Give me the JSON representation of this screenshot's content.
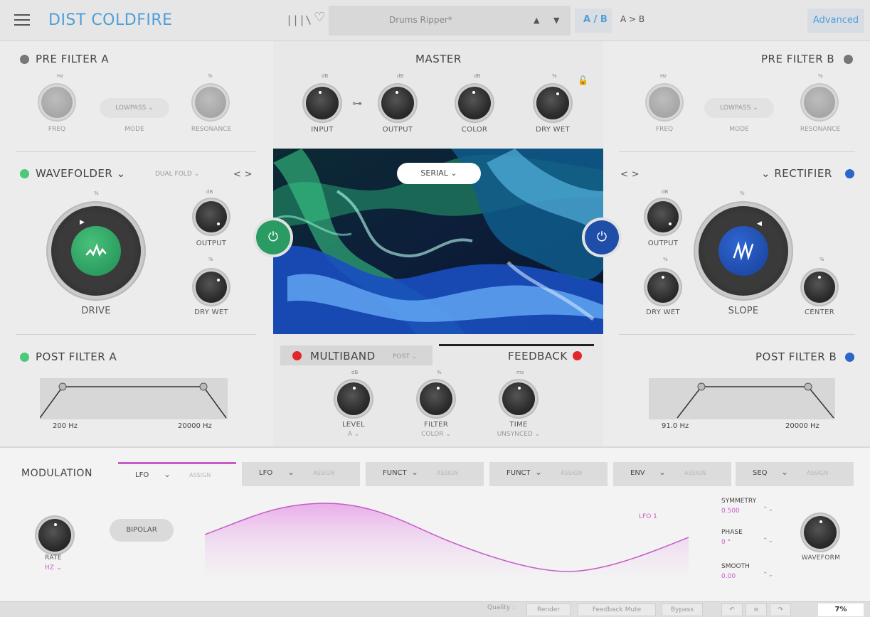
{
  "header": {
    "app_title": "DIST COLDFIRE",
    "menu_icon": "hamburger-icon",
    "library_icon": "library-icon",
    "library_glyph": "|||\\",
    "favorite_icon": "heart-icon",
    "preset_name": "Drums Ripper*",
    "ab_label": "A / B",
    "copy_label": "A > B",
    "advanced_label": "Advanced"
  },
  "pre_filter_a": {
    "title": "PRE FILTER A",
    "freq_label": "FREQ",
    "mode_value": "LOWPASS",
    "mode_label": "MODE",
    "resonance_label": "RESONANCE",
    "freq_unit": "Hz",
    "res_unit": "%"
  },
  "pre_filter_b": {
    "title": "PRE FILTER B",
    "freq_label": "FREQ",
    "mode_value": "LOWPASS",
    "mode_label": "MODE",
    "resonance_label": "RESONANCE",
    "freq_unit": "Hz",
    "res_unit": "%"
  },
  "master": {
    "title": "MASTER",
    "input_label": "INPUT",
    "output_label": "OUTPUT",
    "color_label": "COLOR",
    "drywet_label": "DRY WET",
    "input_unit": "dB",
    "output_unit": "dB",
    "color_unit": "dB",
    "drywet_unit": "%"
  },
  "wavefolder": {
    "title": "WAVEFOLDER",
    "type": "DUAL FOLD",
    "drive_label": "DRIVE",
    "drive_unit": "%",
    "output_label": "OUTPUT",
    "output_unit": "dB",
    "drywet_label": "DRY WET",
    "drywet_unit": "%",
    "nav": "< >"
  },
  "rectifier": {
    "title": "RECTIFIER",
    "slope_label": "SLOPE",
    "slope_unit": "%",
    "output_label": "OUTPUT",
    "output_unit": "dB",
    "drywet_label": "DRY WET",
    "drywet_unit": "%",
    "center_label": "CENTER",
    "center_unit": "%",
    "nav": "< >"
  },
  "routing": {
    "mode": "SERIAL"
  },
  "post_filter_a": {
    "title": "POST FILTER A",
    "low": "200 Hz",
    "high": "20000 Hz"
  },
  "post_filter_b": {
    "title": "POST FILTER B",
    "low": "91.0 Hz",
    "high": "20000 Hz"
  },
  "multiband": {
    "title": "MULTIBAND",
    "position": "POST",
    "feedback_title": "FEEDBACK",
    "level_label": "LEVEL",
    "level_sub": "A",
    "level_unit": "dB",
    "filter_label": "FILTER",
    "filter_sub": "COLOR",
    "filter_unit": "%",
    "time_label": "TIME",
    "time_sub": "UNSYNCED",
    "time_unit": "ms"
  },
  "modulation": {
    "title": "MODULATION",
    "assign_label": "ASSIGN",
    "tabs": [
      {
        "type": "LFO",
        "active": true
      },
      {
        "type": "LFO",
        "active": false
      },
      {
        "type": "FUNCT",
        "active": false
      },
      {
        "type": "FUNCT",
        "active": false
      },
      {
        "type": "ENV",
        "active": false
      },
      {
        "type": "SEQ",
        "active": false
      }
    ],
    "rate_label": "RATE",
    "rate_unit": "HZ",
    "bipolar_label": "BIPOLAR",
    "lfo_name": "LFO 1",
    "symmetry_label": "SYMMETRY",
    "symmetry_value": "0.500",
    "phase_label": "PHASE",
    "phase_value": "0 °",
    "smooth_label": "SMOOTH",
    "smooth_value": "0.00",
    "waveform_label": "WAVEFORM"
  },
  "status": {
    "quality_label": "Quality :",
    "render_label": "Render",
    "feedback_mute_label": "Feedback Mute",
    "bypass_label": "Bypass",
    "zoom": "7%"
  },
  "colors": {
    "accent_blue": "#4e9fd8",
    "green_led": "#4cc97a",
    "blue_led": "#2c66c8",
    "red_led": "#e2262b",
    "mod_pink": "#c55cc8"
  }
}
